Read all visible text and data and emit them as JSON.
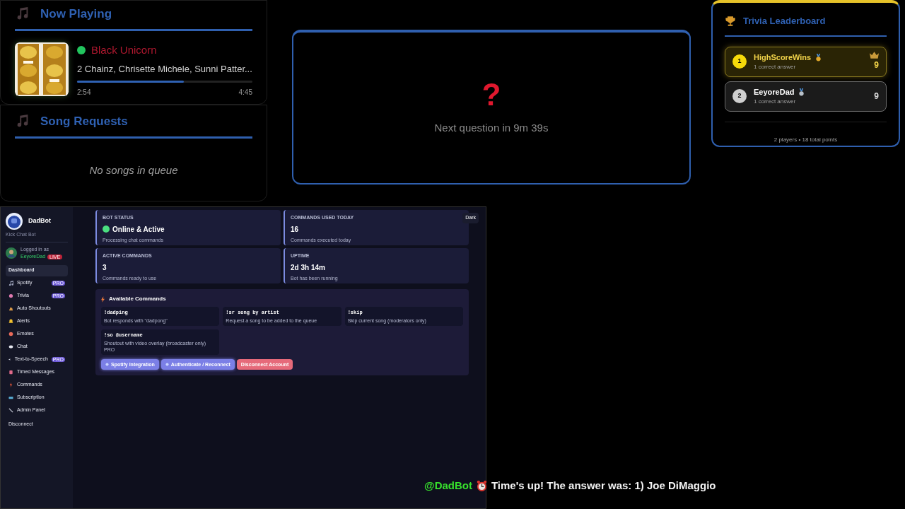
{
  "now_playing": {
    "title": "Now Playing",
    "track": "Black Unicorn",
    "artist": "2 Chainz, Chrisette Michele, Sunni Patter...",
    "playing": true,
    "level": 0.61,
    "elapsed": "2:54",
    "duration": "4:45"
  },
  "song_requests": {
    "title": "Song Requests",
    "empty_text": "No songs in queue"
  },
  "trivia_countdown": {
    "mark": "?",
    "text": "Next question in 9m 39s"
  },
  "leaderboard": {
    "title": "Trivia Leaderboard",
    "players": [
      {
        "rank": "1",
        "name": "HighScoreWins",
        "detail": "1 correct answer",
        "score": "9",
        "leader": true
      },
      {
        "rank": "2",
        "name": "EeyoreDad",
        "detail": "1 correct answer",
        "score": "9",
        "leader": false
      }
    ],
    "footer": "2 players • 18 total points"
  },
  "dashboard": {
    "sidebar": {
      "brand": "DadBot",
      "subtitle": "Kick Chat Bot",
      "login_label": "Logged in as",
      "user": "EeyoreDad",
      "live_badge": "LIVE",
      "items": [
        {
          "label": "Dashboard",
          "selected": true
        },
        {
          "label": "Spotify",
          "selected": false,
          "badge": "PRO"
        },
        {
          "label": "Trivia",
          "selected": false,
          "badge": "PRO"
        },
        {
          "label": "Auto Shoutouts",
          "selected": false
        },
        {
          "label": "Alerts",
          "selected": false
        },
        {
          "label": "Emotes",
          "selected": false
        },
        {
          "label": "Chat",
          "selected": false
        },
        {
          "label": "Text-to-Speech",
          "selected": false,
          "badge": "PRO"
        },
        {
          "label": "Timed Messages",
          "selected": false
        },
        {
          "label": "Commands",
          "selected": false
        },
        {
          "label": "Subscription",
          "selected": false
        },
        {
          "label": "Admin Panel",
          "selected": false
        }
      ],
      "disconnect": "Disconnect"
    },
    "theme_toggle": "Dark",
    "stats": [
      {
        "label": "BOT STATUS",
        "value": "Online & Active",
        "note": "Processing chat commands",
        "online": true
      },
      {
        "label": "COMMANDS USED TODAY",
        "value": "16",
        "note": "Commands executed today"
      },
      {
        "label": "ACTIVE COMMANDS",
        "value": "3",
        "note": "Commands ready to use"
      },
      {
        "label": "UPTIME",
        "value": "2d 3h 14m",
        "note": "Bot has been running"
      }
    ],
    "commands_title": "Available Commands",
    "commands": [
      {
        "name": "!dadping",
        "description": "Bot responds with \"dadpong\""
      },
      {
        "name": "!sr song by artist",
        "description": "Request a song to be added to the queue"
      },
      {
        "name": "!skip",
        "description": "Skip current song (moderators only)"
      },
      {
        "name": "!so @username",
        "description": "Shoutout with video overlay (broadcaster only) PRO"
      }
    ],
    "buttons": [
      {
        "label": "Spotify Integration",
        "kind": "primary"
      },
      {
        "label": "Authenticate / Reconnect",
        "kind": "primary"
      },
      {
        "label": "Disconnect Account",
        "kind": "danger"
      }
    ]
  },
  "chat": {
    "user": "@DadBot",
    "message": "Time's up! The answer was: 1) Joe DiMaggio"
  }
}
